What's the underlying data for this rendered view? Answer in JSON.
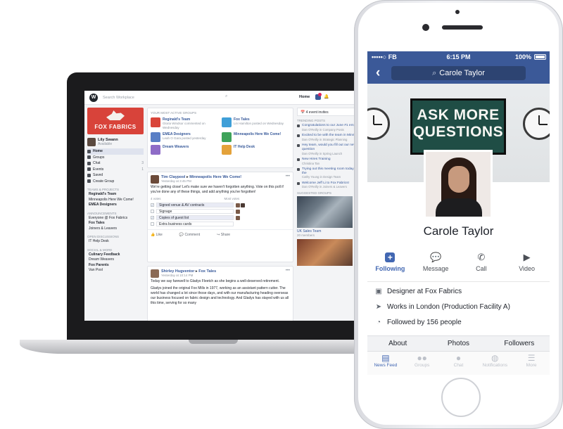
{
  "laptop": {
    "search_placeholder": "Search Workplace",
    "home_label": "Home",
    "brand_text": "FOX FABRICS",
    "profile": {
      "name": "Lily Swann",
      "status": "Available"
    },
    "nav_items": [
      {
        "label": "Home",
        "count": ""
      },
      {
        "label": "Groups",
        "count": ""
      },
      {
        "label": "Chat",
        "count": "3"
      },
      {
        "label": "Events",
        "count": "1"
      },
      {
        "label": "Saved",
        "count": ""
      },
      {
        "label": "Create Group",
        "count": ""
      }
    ],
    "sections": [
      {
        "header": "TEAMS & PROJECTS",
        "items": [
          {
            "label": "Reginald's Team",
            "bold": true
          },
          {
            "label": "Minneapolis Here We Come!",
            "bold": false
          },
          {
            "label": "EMEA Designers",
            "bold": true
          }
        ]
      },
      {
        "header": "ANNOUNCEMENTS",
        "items": [
          {
            "label": "Everyone @ Fox Fabrics",
            "bold": false
          },
          {
            "label": "Fox Tales",
            "bold": true
          },
          {
            "label": "Joiners & Leavers",
            "bold": false
          }
        ]
      },
      {
        "header": "OPEN DISCUSSIONS",
        "items": [
          {
            "label": "IT Help Desk",
            "bold": false
          }
        ]
      },
      {
        "header": "SOCIAL & MORE",
        "items": [
          {
            "label": "Culinary Feedback",
            "bold": true
          },
          {
            "label": "Dream Weavers",
            "bold": false
          },
          {
            "label": "Fox Parents",
            "bold": true
          },
          {
            "label": "Van Pool",
            "bold": false
          }
        ]
      }
    ],
    "groups_card": {
      "title": "YOUR MOST ACTIVE GROUPS",
      "groups": [
        {
          "name": "Reginald's Team",
          "sub": "Gloria Windsor commented on Wednesday",
          "color": "#d9453a"
        },
        {
          "name": "Fox Tales",
          "sub": "Lin Hamilton posted on Wednesday",
          "color": "#3f9fd8"
        },
        {
          "name": "EMEA Designers",
          "sub": "Leah O Gara posted yesterday",
          "color": "#5a7fc6"
        },
        {
          "name": "Minneapolis Here We Come!",
          "sub": "",
          "color": "#3ea35a"
        },
        {
          "name": "Dream Weavers",
          "sub": "",
          "color": "#8e6cc7"
        },
        {
          "name": "IT Help Desk",
          "sub": "",
          "color": "#e4a23a"
        }
      ]
    },
    "poll_post": {
      "author": "Tim Claypool",
      "target": "Minneapolis Here We Come!",
      "meta": "Yesterday at 3:45 PM",
      "body": "We're getting close! Let's make sure we haven't forgotten anything. Vote on this poll if you've done any of these things, and add anything you've forgotten!",
      "votes_label": "4 votes",
      "sort_label": "Most votes",
      "options": [
        {
          "label": "Signed venue & AV contracts",
          "voted": true
        },
        {
          "label": "Signage",
          "voted": false
        },
        {
          "label": "Copies of guest list",
          "voted": true
        },
        {
          "label": "Extra business cards",
          "voted": false
        }
      ],
      "actions": [
        "Like",
        "Comment",
        "Share"
      ]
    },
    "text_post": {
      "author": "Shirley Hugventor",
      "target": "Fox Tales",
      "meta": "Yesterday at 10:14 PM",
      "body": "Today we say farewell to Gladys Fleetch as she begins a well-deserved retirement.",
      "body2": "Gladys joined the original Fox Mills in 1977, working as an assistant pattern cutter. The world has changed a lot since those days, and with our manufacturing heading overseas our business focused on fabric design and technology. And Gladys has stayed with us all this time, serving for so many"
    },
    "right": {
      "events": "4 event invites",
      "trending_title": "TRENDING POSTS",
      "trending": [
        {
          "title": "Congratulations to our June #1 employee",
          "sub": "Dan O'Reilly in Company Posts"
        },
        {
          "title": "Excited to be with the team in Minneapolis for a",
          "sub": "Dan O'Reilly in Strategic Planning"
        },
        {
          "title": "Hey team, would you fill out our new design question",
          "sub": "Dan O'Reilly in Spring Launch"
        },
        {
          "title": "New Hires Training",
          "sub": "Christina Tan"
        },
        {
          "title": "Trying out this meeting room today, check out the",
          "sub": "Cathy Young in Design Team"
        },
        {
          "title": "Welcome Jeff Li to Fox Fabrics!",
          "sub": "Dan O'Reilly in Joiners & Leavers"
        }
      ],
      "suggested_title": "SUGGESTED GROUPS",
      "suggested_name": "UK Sales Team",
      "suggested_sub": "20 members"
    }
  },
  "phone": {
    "status": {
      "carrier": "FB",
      "time": "6:15 PM",
      "battery": "100%"
    },
    "search_value": "Carole Taylor",
    "poster_line1": "ASK MORE",
    "poster_line2": "QUESTIONS",
    "name": "Carole Taylor",
    "actions": [
      {
        "label": "Following",
        "icon": "follow-icon",
        "active": true
      },
      {
        "label": "Message",
        "icon": "message-icon",
        "active": false
      },
      {
        "label": "Call",
        "icon": "phone-icon",
        "active": false
      },
      {
        "label": "Video",
        "icon": "video-icon",
        "active": false
      }
    ],
    "info": [
      {
        "icon": "briefcase-icon",
        "text": "Designer at Fox Fabrics"
      },
      {
        "icon": "location-icon",
        "text": "Works in London (Production Facility A)"
      },
      {
        "icon": "rss-icon",
        "text": "Followed by 156 people"
      }
    ],
    "tabs": [
      "About",
      "Photos",
      "Followers"
    ],
    "bottom_nav": [
      {
        "label": "News Feed",
        "icon": "newsfeed-icon",
        "active": true
      },
      {
        "label": "Groups",
        "icon": "groups-icon",
        "active": false
      },
      {
        "label": "Chat",
        "icon": "chat-icon",
        "active": false
      },
      {
        "label": "Notifications",
        "icon": "globe-icon",
        "active": false
      },
      {
        "label": "More",
        "icon": "menu-icon",
        "active": false
      }
    ],
    "accent": "#3b5998"
  }
}
